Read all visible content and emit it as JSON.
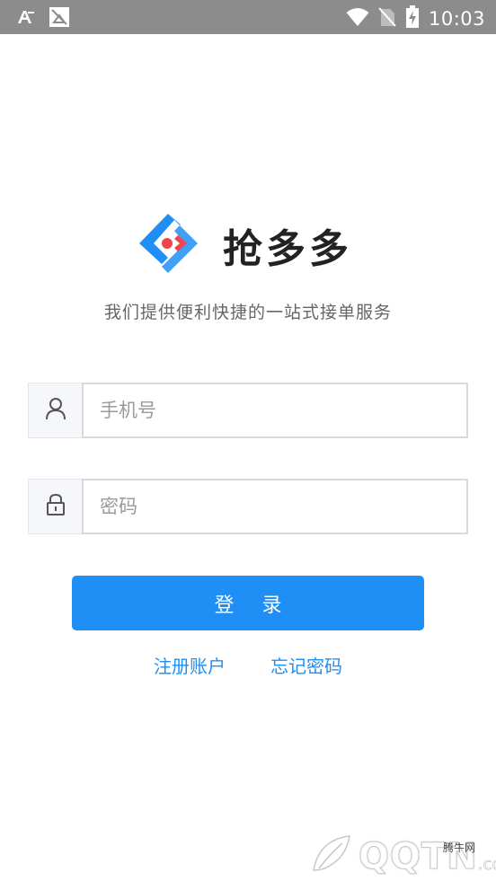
{
  "status_bar": {
    "time": "10:03",
    "icons": [
      "font-a-icon",
      "image-notification-icon",
      "wifi-icon",
      "no-sim-icon",
      "battery-charging-icon"
    ]
  },
  "brand": {
    "title": "抢多多",
    "logo_colors": {
      "blue": "#1f8ef5",
      "red": "#f0464b"
    }
  },
  "tagline": "我们提供便利快捷的一站式接单服务",
  "form": {
    "phone_placeholder": "手机号",
    "phone_icon": "user-icon",
    "password_placeholder": "密码",
    "password_icon": "lock-icon",
    "login_label": "登 录"
  },
  "links": {
    "register": "注册账户",
    "forgot": "忘记密码"
  },
  "watermark": {
    "text": "QQTN",
    "suffix": ".com",
    "label": "腾牛网"
  },
  "colors": {
    "accent": "#1f8ef5",
    "status_bar": "#8c8c8c"
  }
}
